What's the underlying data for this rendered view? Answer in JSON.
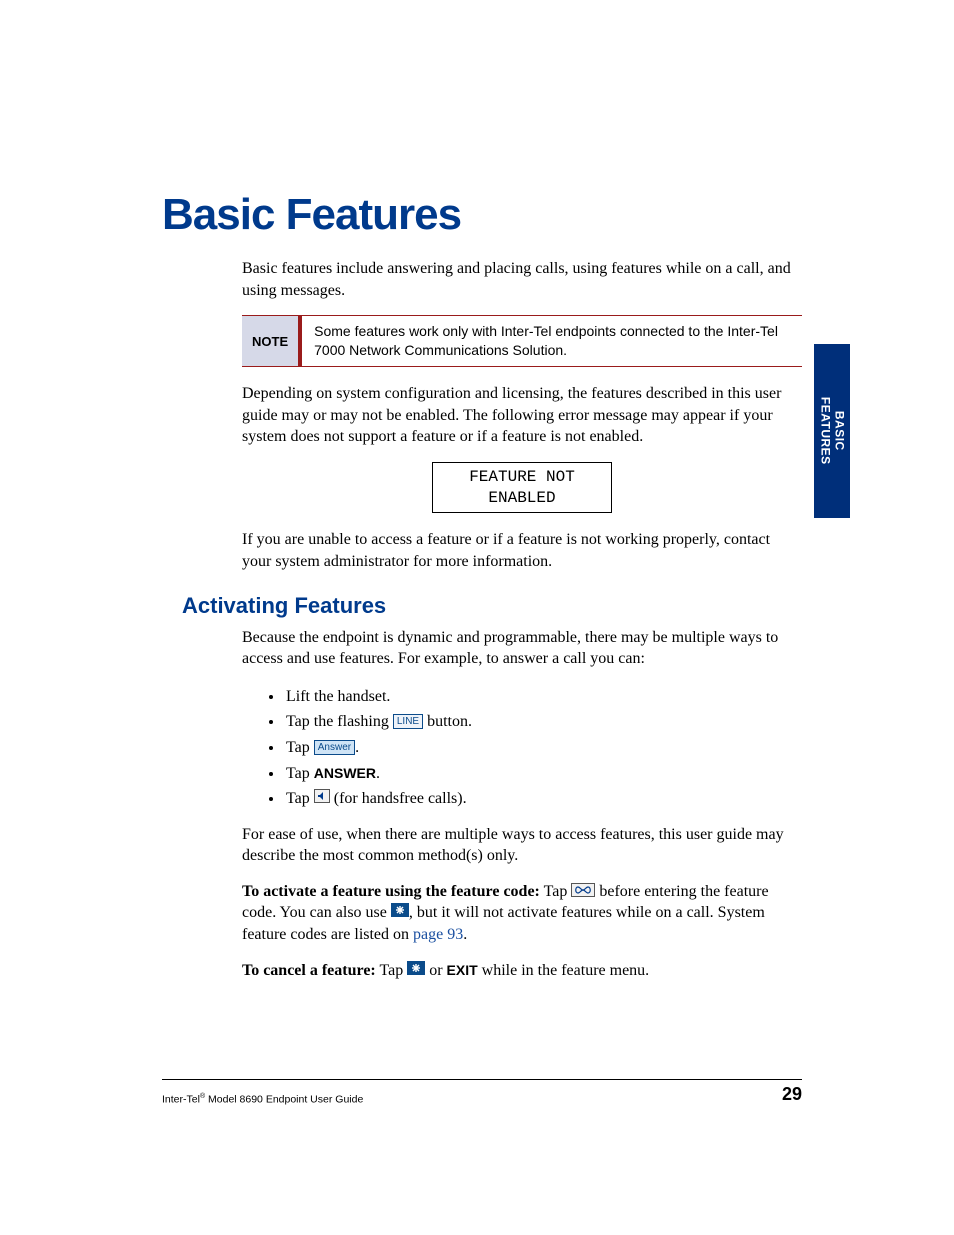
{
  "chapter_title": "Basic Features",
  "intro": "Basic features include answering and placing calls, using features while on a call, and using messages.",
  "note": {
    "label": "NOTE",
    "text": "Some features work only with Inter-Tel endpoints connected to the Inter-Tel 7000 Network Communications Solution."
  },
  "para2": "Depending on system configuration and licensing, the features described in this user guide may or may not be enabled. The following error message may appear if your system does not support a feature or if a feature is not enabled.",
  "display": {
    "line1": "FEATURE NOT",
    "line2": "ENABLED"
  },
  "para3": "If you are unable to access a feature or if a feature is not working properly, contact your system administrator for more information.",
  "section": {
    "title": "Activating Features",
    "intro": "Because the endpoint is dynamic and programmable, there may be multiple ways to access and use features. For example, to answer a call you can:",
    "bullets": {
      "b1": "Lift the handset.",
      "b2_pre": "Tap the flashing ",
      "b2_btn": "LINE",
      "b2_post": " button.",
      "b3_pre": "Tap ",
      "b3_btn": "Answer",
      "b3_post": ".",
      "b4_pre": "Tap ",
      "b4_bold": "ANSWER",
      "b4_post": ".",
      "b5_pre": "Tap ",
      "b5_post": " (for handsfree calls)."
    },
    "outro": "For ease of use, when there are multiple ways to access features, this user guide may describe the most common method(s) only.",
    "activate": {
      "lead": "To activate a feature using the feature code:",
      "seg1": " Tap ",
      "seg2": " before entering the feature code. You can also use ",
      "seg3": ", but it will not activate features while on a call. System feature codes are listed on ",
      "link": "page 93",
      "seg4": "."
    },
    "cancel": {
      "lead": "To cancel a feature:",
      "seg1": " Tap ",
      "seg2": " or ",
      "exit": "EXIT",
      "seg3": " while in the feature menu."
    }
  },
  "sidetab": {
    "line1": "BASIC",
    "line2": "FEATURES"
  },
  "footer": {
    "left_pre": "Inter-Tel",
    "left_sup": "®",
    "left_post": " Model 8690 Endpoint User Guide",
    "page": "29"
  },
  "icons": {
    "line_button": "LINE",
    "answer_button": "Answer",
    "speaker": "speaker-icon",
    "infinity": "infinity-icon",
    "asterisk": "asterisk-key-icon"
  }
}
